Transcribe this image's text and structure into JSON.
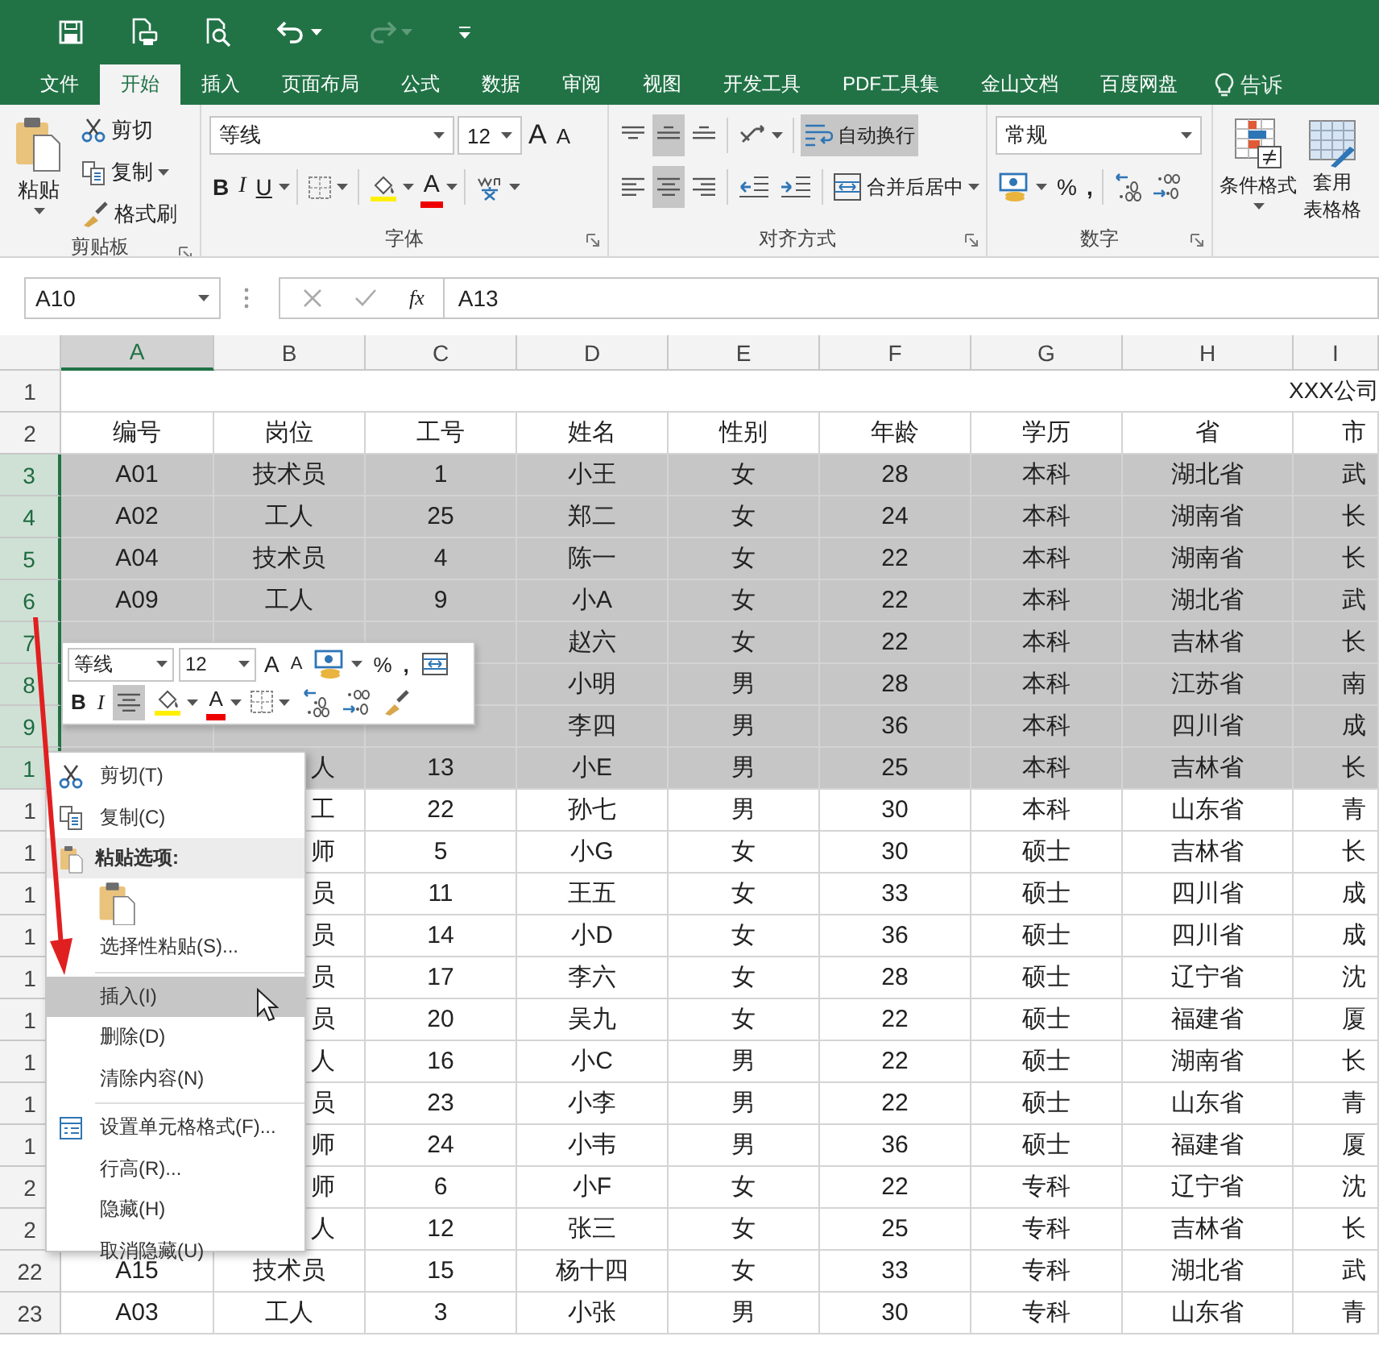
{
  "tabs": [
    {
      "label": "文件",
      "selected": false
    },
    {
      "label": "开始",
      "selected": true
    },
    {
      "label": "插入",
      "selected": false
    },
    {
      "label": "页面布局",
      "selected": false
    },
    {
      "label": "公式",
      "selected": false
    },
    {
      "label": "数据",
      "selected": false
    },
    {
      "label": "审阅",
      "selected": false
    },
    {
      "label": "视图",
      "selected": false
    },
    {
      "label": "开发工具",
      "selected": false
    },
    {
      "label": "PDF工具集",
      "selected": false
    },
    {
      "label": "金山文档",
      "selected": false
    },
    {
      "label": "百度网盘",
      "selected": false
    }
  ],
  "tell_me": "告诉",
  "ribbon": {
    "clipboard": {
      "label": "剪贴板",
      "paste": "粘贴",
      "cut": "剪切",
      "copy": "复制",
      "format_painter": "格式刷"
    },
    "font": {
      "label": "字体",
      "name": "等线",
      "size": "12",
      "grow": "A",
      "shrink": "A",
      "bold": "B",
      "italic": "I",
      "underline": "U",
      "font_color": "A"
    },
    "alignment": {
      "label": "对齐方式",
      "vertical_align": [
        {
          "selected": false
        },
        {
          "selected": true
        },
        {
          "selected": false
        }
      ],
      "horizontal_align": [
        {
          "selected": false
        },
        {
          "selected": true
        },
        {
          "selected": false
        }
      ],
      "wrap_text": {
        "label": "自动换行",
        "on": true
      },
      "merge": "合并后居中"
    },
    "number": {
      "label": "数字",
      "format": "常规",
      "percent": "%",
      "comma": ","
    },
    "styles": {
      "conditional": "条件格式",
      "table_format": [
        "套用",
        "表格格"
      ]
    }
  },
  "formula_bar": {
    "name_box": "A10",
    "fx": "fx",
    "formula": "A13"
  },
  "sheet": {
    "title": "XXX公司",
    "columns": [
      {
        "label": "A",
        "selected": true
      },
      {
        "label": "B",
        "selected": false
      },
      {
        "label": "C",
        "selected": false
      },
      {
        "label": "D",
        "selected": false
      },
      {
        "label": "E",
        "selected": false
      },
      {
        "label": "F",
        "selected": false
      },
      {
        "label": "G",
        "selected": false
      },
      {
        "label": "H",
        "selected": false
      },
      {
        "label": "I",
        "selected": false
      }
    ],
    "rows": [
      {
        "header": "1",
        "selected": false,
        "kind": "title"
      },
      {
        "header": "2",
        "selected": false,
        "kind": "data",
        "cells": [
          "编号",
          "岗位",
          "工号",
          "姓名",
          "性别",
          "年龄",
          "学历",
          "省",
          "市"
        ]
      },
      {
        "header": "3",
        "selected": true,
        "kind": "data",
        "cells": [
          "A01",
          "技术员",
          "1",
          "小王",
          "女",
          "28",
          "本科",
          "湖北省",
          "武"
        ]
      },
      {
        "header": "4",
        "selected": true,
        "kind": "data",
        "cells": [
          "A02",
          "工人",
          "25",
          "郑二",
          "女",
          "24",
          "本科",
          "湖南省",
          "长"
        ]
      },
      {
        "header": "5",
        "selected": true,
        "kind": "data",
        "cells": [
          "A04",
          "技术员",
          "4",
          "陈一",
          "女",
          "22",
          "本科",
          "湖南省",
          "长"
        ]
      },
      {
        "header": "6",
        "selected": true,
        "kind": "data",
        "cells": [
          "A09",
          "工人",
          "9",
          "小A",
          "女",
          "22",
          "本科",
          "湖北省",
          "武"
        ]
      },
      {
        "header": "7",
        "selected": true,
        "kind": "data",
        "cells": [
          null,
          null,
          null,
          "赵六",
          "女",
          "22",
          "本科",
          "吉林省",
          "长"
        ]
      },
      {
        "header": "8",
        "selected": true,
        "kind": "data",
        "cells": [
          null,
          null,
          null,
          "小明",
          "男",
          "28",
          "本科",
          "江苏省",
          "南"
        ]
      },
      {
        "header": "9",
        "selected": true,
        "kind": "data",
        "cells": [
          null,
          null,
          null,
          "李四",
          "男",
          "36",
          "本科",
          "四川省",
          "成"
        ]
      },
      {
        "header": "1",
        "selected": true,
        "kind": "data",
        "cells": [
          null,
          "人",
          "13",
          "小E",
          "男",
          "25",
          "本科",
          "吉林省",
          "长"
        ]
      },
      {
        "header": "1",
        "selected": false,
        "kind": "data",
        "cells": [
          null,
          "工",
          "22",
          "孙七",
          "男",
          "30",
          "本科",
          "山东省",
          "青"
        ]
      },
      {
        "header": "1",
        "selected": false,
        "kind": "data",
        "cells": [
          null,
          "师",
          "5",
          "小G",
          "女",
          "30",
          "硕士",
          "吉林省",
          "长"
        ]
      },
      {
        "header": "1",
        "selected": false,
        "kind": "data",
        "cells": [
          null,
          "员",
          "11",
          "王五",
          "女",
          "33",
          "硕士",
          "四川省",
          "成"
        ]
      },
      {
        "header": "1",
        "selected": false,
        "kind": "data",
        "cells": [
          null,
          "员",
          "14",
          "小D",
          "女",
          "36",
          "硕士",
          "四川省",
          "成"
        ]
      },
      {
        "header": "1",
        "selected": false,
        "kind": "data",
        "cells": [
          null,
          "员",
          "17",
          "李六",
          "女",
          "28",
          "硕士",
          "辽宁省",
          "沈"
        ]
      },
      {
        "header": "1",
        "selected": false,
        "kind": "data",
        "cells": [
          null,
          "员",
          "20",
          "吴九",
          "女",
          "22",
          "硕士",
          "福建省",
          "厦"
        ]
      },
      {
        "header": "1",
        "selected": false,
        "kind": "data",
        "cells": [
          null,
          "人",
          "16",
          "小C",
          "男",
          "22",
          "硕士",
          "湖南省",
          "长"
        ]
      },
      {
        "header": "1",
        "selected": false,
        "kind": "data",
        "cells": [
          null,
          "员",
          "23",
          "小李",
          "男",
          "22",
          "硕士",
          "山东省",
          "青"
        ]
      },
      {
        "header": "1",
        "selected": false,
        "kind": "data",
        "cells": [
          null,
          "师",
          "24",
          "小韦",
          "男",
          "36",
          "硕士",
          "福建省",
          "厦"
        ]
      },
      {
        "header": "2",
        "selected": false,
        "kind": "data",
        "cells": [
          null,
          "师",
          "6",
          "小F",
          "女",
          "22",
          "专科",
          "辽宁省",
          "沈"
        ]
      },
      {
        "header": "2",
        "selected": false,
        "kind": "data",
        "cells": [
          null,
          "人",
          "12",
          "张三",
          "女",
          "25",
          "专科",
          "吉林省",
          "长"
        ]
      },
      {
        "header": "22",
        "selected": false,
        "kind": "data",
        "cells": [
          "A15",
          "技术员",
          "15",
          "杨十四",
          "女",
          "33",
          "专科",
          "湖北省",
          "武"
        ]
      },
      {
        "header": "23",
        "selected": false,
        "kind": "data",
        "cells": [
          "A03",
          "工人",
          "3",
          "小张",
          "男",
          "30",
          "专科",
          "山东省",
          "青"
        ]
      }
    ]
  },
  "mini_toolbar": {
    "font": "等线",
    "size": "12",
    "grow": "A",
    "shrink": "A",
    "percent": "%",
    "comma": ",",
    "bold": "B",
    "italic": "I",
    "center_on": true,
    "font_color": "A"
  },
  "context_menu": {
    "items": [
      {
        "kind": "item",
        "label": "剪切(T)",
        "selected": false
      },
      {
        "kind": "item",
        "label": "复制(C)",
        "selected": false
      },
      {
        "kind": "header",
        "label": "粘贴选项:"
      },
      {
        "kind": "paste_options"
      },
      {
        "kind": "item",
        "label": "选择性粘贴(S)...",
        "selected": false
      },
      {
        "kind": "separator"
      },
      {
        "kind": "item",
        "label": "插入(I)",
        "selected": true
      },
      {
        "kind": "item",
        "label": "删除(D)",
        "selected": false
      },
      {
        "kind": "item",
        "label": "清除内容(N)",
        "selected": false
      },
      {
        "kind": "separator"
      },
      {
        "kind": "item",
        "label": "设置单元格格式(F)...",
        "selected": false
      },
      {
        "kind": "item",
        "label": "行高(R)...",
        "selected": false
      },
      {
        "kind": "item",
        "label": "隐藏(H)",
        "selected": false
      },
      {
        "kind": "item",
        "label": "取消隐藏(U)",
        "selected": false
      }
    ]
  }
}
